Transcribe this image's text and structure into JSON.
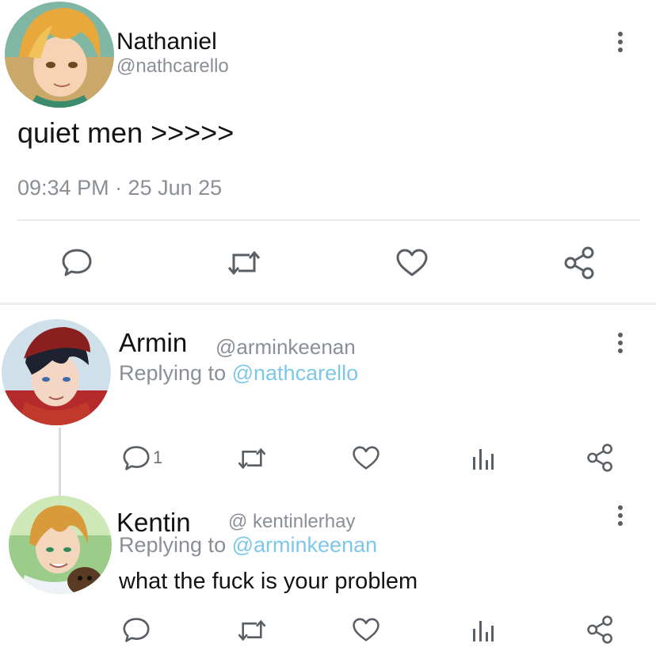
{
  "main_post": {
    "author_name": "Nathaniel",
    "author_handle": "@nathcarello",
    "text": "quiet men >>>>>",
    "timestamp": "09:34 PM · 25 Jun 25",
    "actions": {
      "reply_icon": "comment-icon",
      "retweet_icon": "retweet-icon",
      "like_icon": "heart-icon",
      "share_icon": "share-icon"
    }
  },
  "replies": [
    {
      "author_name": "Armin",
      "author_handle": "@arminkeenan",
      "replying_label": "Replying to",
      "replying_to": "@nathcarello",
      "text": "",
      "reply_count": "1"
    },
    {
      "author_name": "Kentin",
      "author_handle": "@ kentinlerhay",
      "replying_label": "Replying to",
      "replying_to": "@arminkeenan",
      "text": "what the fuck is your problem",
      "reply_count": ""
    }
  ],
  "colors": {
    "accent": "#7dc7ea",
    "icon_gray": "#5a5f66",
    "secondary_text": "#8a8f96",
    "divider": "#e8eaec"
  }
}
